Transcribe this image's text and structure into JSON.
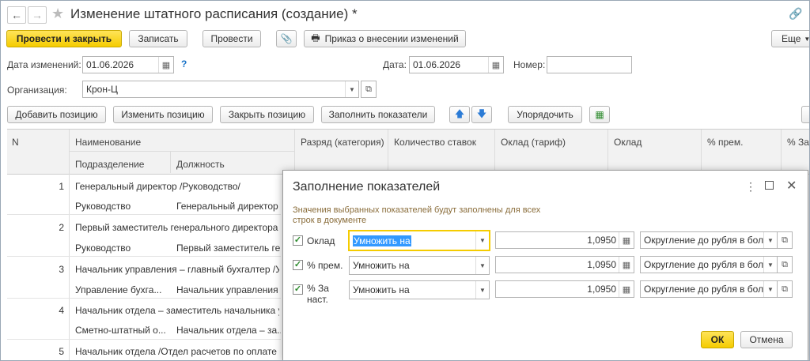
{
  "window": {
    "title": "Изменение штатного расписания (создание) *"
  },
  "toolbar": {
    "post_close": "Провести и закрыть",
    "save": "Записать",
    "post": "Провести",
    "order": "Приказ о внесении изменений",
    "more": "Еще"
  },
  "form": {
    "date_changes_label": "Дата изменений:",
    "date_changes": "01.06.2026",
    "help": "?",
    "date_label": "Дата:",
    "date": "01.06.2026",
    "number_label": "Номер:",
    "number": "",
    "org_label": "Организация:",
    "org": "Крон-Ц"
  },
  "actions": {
    "add": "Добавить позицию",
    "edit": "Изменить позицию",
    "close": "Закрыть позицию",
    "fill": "Заполнить показатели",
    "sort": "Упорядочить"
  },
  "table": {
    "headers": {
      "n": "N",
      "name": "Наименование",
      "dept": "Подразделение",
      "position": "Должность",
      "grade": "Разряд (категория)",
      "rates": "Количество ставок",
      "tariff": "Оклад (тариф)",
      "salary": "Оклад",
      "bonus": "% прем.",
      "more": "% За"
    },
    "rows": [
      {
        "n": "1",
        "name": "Генеральный директор /Руководство/",
        "dept": "Руководство",
        "position": "Генеральный директор"
      },
      {
        "n": "2",
        "name": "Первый заместитель генерального директора /...",
        "dept": "Руководство",
        "position": "Первый заместитель ге..."
      },
      {
        "n": "3",
        "name": "Начальник управления – главный бухгалтер /У...",
        "dept": "Управление бухга...",
        "position": "Начальник управления ..."
      },
      {
        "n": "4",
        "name": "Начальник отдела – заместитель начальника у...",
        "dept": "Сметно-штатный о...",
        "position": "Начальник отдела – за..."
      },
      {
        "n": "5",
        "name": "Начальник отдела /Отдел расчетов по оплате т...",
        "dept": "",
        "position": ""
      }
    ]
  },
  "dialog": {
    "title": "Заполнение показателей",
    "info": "Значения выбранных показателей будут заполнены для всех строк в документе",
    "rows": [
      {
        "label": "Оклад",
        "op": "Умножить на",
        "value": "1,0950",
        "round": "Округление до рубля в бол"
      },
      {
        "label": "% прем.",
        "op": "Умножить на",
        "value": "1,0950",
        "round": "Округление до рубля в бол"
      },
      {
        "label": "%   За наст.",
        "op": "Умножить на",
        "value": "1,0950",
        "round": "Округление до рубля в бол"
      }
    ],
    "ok": "ОК",
    "cancel": "Отмена"
  }
}
